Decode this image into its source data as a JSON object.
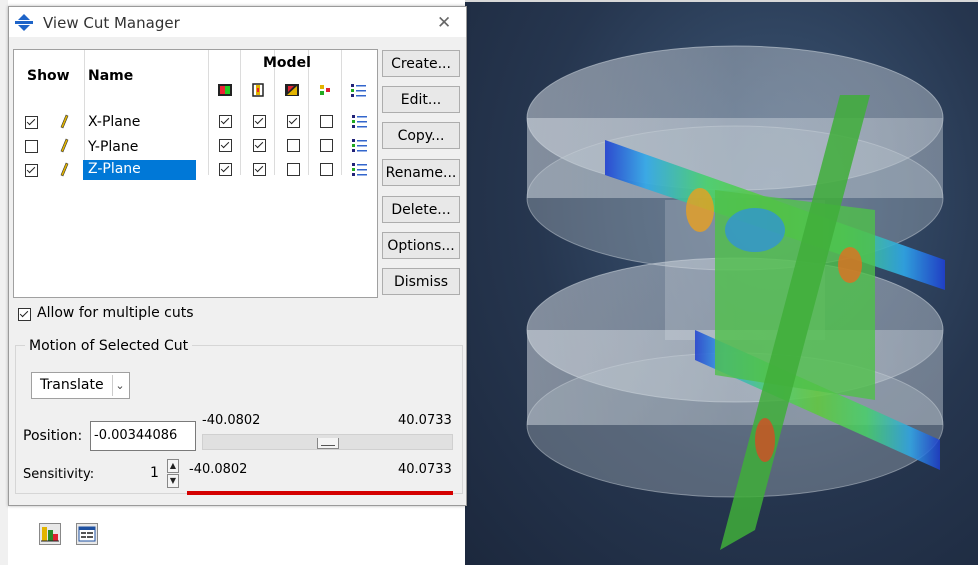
{
  "dialog": {
    "title": "View Cut Manager",
    "close_glyph": "✕"
  },
  "table": {
    "headers": {
      "show": "Show",
      "name": "Name",
      "model": "Model"
    },
    "model_icons": [
      "contour-fill-icon",
      "cut-plane-icon",
      "section-color-icon",
      "free-body-icon",
      "list-icon"
    ],
    "rows": [
      {
        "name": "X-Plane",
        "show": true,
        "model": [
          true,
          true,
          true,
          false
        ],
        "selected": false
      },
      {
        "name": "Y-Plane",
        "show": false,
        "model": [
          true,
          true,
          false,
          false
        ],
        "selected": false
      },
      {
        "name": "Z-Plane",
        "show": true,
        "model": [
          true,
          true,
          false,
          false
        ],
        "selected": true
      }
    ]
  },
  "buttons": {
    "create": "Create...",
    "edit": "Edit...",
    "copy": "Copy...",
    "rename": "Rename...",
    "delete": "Delete...",
    "options": "Options...",
    "dismiss": "Dismiss"
  },
  "allow_multiple": {
    "label": "Allow for multiple cuts",
    "checked": true
  },
  "motion": {
    "group_title": "Motion of Selected Cut",
    "mode": "Translate",
    "position_label": "Position:",
    "position_value": "-0.00344086",
    "position_min": "-40.0802",
    "position_max": "40.0733",
    "position_fraction": 0.5,
    "sensitivity_label": "Sensitivity:",
    "sensitivity_value": "1",
    "sensitivity_min": "-40.0802",
    "sensitivity_max": "40.0733"
  },
  "colors": {
    "selection": "#0078d7",
    "sensitivity_bar": "#d40000",
    "viewport_bg": "#26364f"
  },
  "toolbar": {
    "icons": [
      "view-cut-tool-icon",
      "viewport-annotation-icon"
    ]
  }
}
